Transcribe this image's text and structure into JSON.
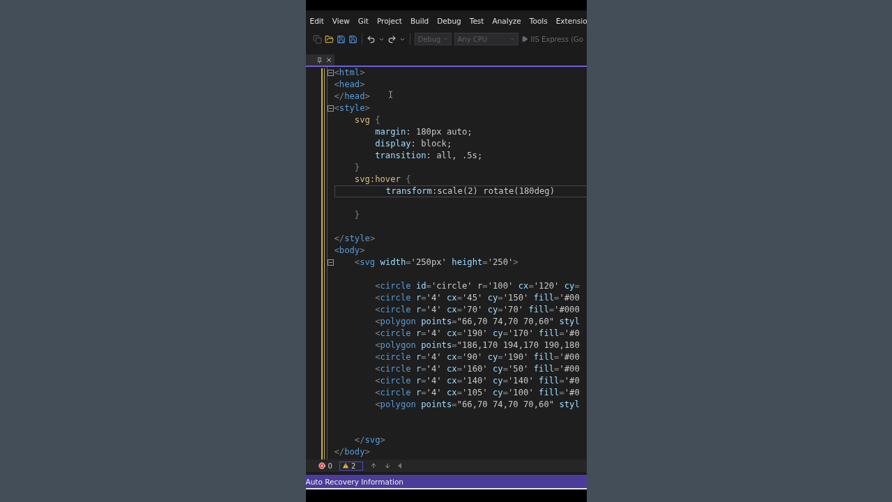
{
  "menu": [
    {
      "label": "Edit"
    },
    {
      "label": "View"
    },
    {
      "label": "Git"
    },
    {
      "label": "Project"
    },
    {
      "label": "Build"
    },
    {
      "label": "Debug"
    },
    {
      "label": "Test"
    },
    {
      "label": "Analyze"
    },
    {
      "label": "Tools"
    },
    {
      "label": "Extensio"
    }
  ],
  "toolbar": {
    "configuration": {
      "value": "Debug",
      "disabled": true
    },
    "platform": {
      "value": "Any CPU",
      "disabled": true
    },
    "run": {
      "label": "IIS Express (Go",
      "disabled": true
    }
  },
  "editor": {
    "lines": [
      {
        "kind": "code",
        "fold": true,
        "segments": [
          {
            "kind": "punct",
            "text": "<"
          },
          {
            "kind": "tag",
            "text": "html"
          },
          {
            "kind": "punct",
            "text": ">"
          }
        ]
      },
      {
        "kind": "code",
        "segments": [
          {
            "kind": "punct",
            "text": "<"
          },
          {
            "kind": "tag",
            "text": "head"
          },
          {
            "kind": "punct",
            "text": ">"
          }
        ]
      },
      {
        "kind": "code",
        "segments": [
          {
            "kind": "punct",
            "text": "</"
          },
          {
            "kind": "tag",
            "text": "head"
          },
          {
            "kind": "punct",
            "text": ">"
          }
        ]
      },
      {
        "kind": "code",
        "fold": true,
        "segments": [
          {
            "kind": "punct",
            "text": "<"
          },
          {
            "kind": "tag",
            "text": "style"
          },
          {
            "kind": "punct",
            "text": ">"
          }
        ]
      },
      {
        "kind": "code",
        "segments": [
          {
            "kind": "selector",
            "text": "    svg"
          },
          {
            "kind": "punct",
            "text": " {"
          }
        ]
      },
      {
        "kind": "code",
        "segments": [
          {
            "kind": "property",
            "text": "        margin"
          },
          {
            "kind": "value",
            "text": ": 180px auto;"
          }
        ]
      },
      {
        "kind": "code",
        "segments": [
          {
            "kind": "property",
            "text": "        display"
          },
          {
            "kind": "value",
            "text": ": block;"
          }
        ]
      },
      {
        "kind": "code",
        "segments": [
          {
            "kind": "property",
            "text": "        transition"
          },
          {
            "kind": "value",
            "text": ": all, .5s;"
          }
        ]
      },
      {
        "kind": "code",
        "segments": [
          {
            "kind": "punct",
            "text": "    }"
          }
        ]
      },
      {
        "kind": "code",
        "segments": [
          {
            "kind": "selector",
            "text": "    svg:hover"
          },
          {
            "kind": "punct",
            "text": " {"
          }
        ]
      },
      {
        "kind": "code",
        "current": true,
        "segments": [
          {
            "kind": "property",
            "text": "          transform"
          },
          {
            "kind": "value",
            "text": ":scale(2) rotate(180deg)"
          }
        ]
      },
      {
        "kind": "blank"
      },
      {
        "kind": "code",
        "segments": [
          {
            "kind": "punct",
            "text": "    }"
          }
        ]
      },
      {
        "kind": "blank"
      },
      {
        "kind": "code",
        "segments": [
          {
            "kind": "punct",
            "text": "</"
          },
          {
            "kind": "tag",
            "text": "style"
          },
          {
            "kind": "punct",
            "text": ">"
          }
        ]
      },
      {
        "kind": "code",
        "segments": [
          {
            "kind": "punct",
            "text": "<"
          },
          {
            "kind": "tag",
            "text": "body"
          },
          {
            "kind": "punct",
            "text": ">"
          }
        ]
      },
      {
        "kind": "code",
        "fold": true,
        "segments": [
          {
            "kind": "punct",
            "text": "    <"
          },
          {
            "kind": "tag",
            "text": "svg"
          },
          {
            "kind": "attr",
            "text": " width"
          },
          {
            "kind": "punct",
            "text": "="
          },
          {
            "kind": "value",
            "text": "'250px'"
          },
          {
            "kind": "attr",
            "text": " height"
          },
          {
            "kind": "punct",
            "text": "="
          },
          {
            "kind": "value",
            "text": "'250'"
          },
          {
            "kind": "punct",
            "text": ">"
          }
        ]
      },
      {
        "kind": "blank"
      },
      {
        "kind": "code",
        "segments": [
          {
            "kind": "punct",
            "text": "        <"
          },
          {
            "kind": "tag",
            "text": "circle"
          },
          {
            "kind": "attr",
            "text": " id"
          },
          {
            "kind": "punct",
            "text": "="
          },
          {
            "kind": "value",
            "text": "'circle'"
          },
          {
            "kind": "attr",
            "text": " r"
          },
          {
            "kind": "punct",
            "text": "="
          },
          {
            "kind": "value",
            "text": "'100'"
          },
          {
            "kind": "attr",
            "text": " cx"
          },
          {
            "kind": "punct",
            "text": "="
          },
          {
            "kind": "value",
            "text": "'120'"
          },
          {
            "kind": "attr",
            "text": " cy"
          },
          {
            "kind": "punct",
            "text": "="
          }
        ]
      },
      {
        "kind": "code",
        "segments": [
          {
            "kind": "punct",
            "text": "        <"
          },
          {
            "kind": "tag",
            "text": "circle"
          },
          {
            "kind": "attr",
            "text": " r"
          },
          {
            "kind": "punct",
            "text": "="
          },
          {
            "kind": "value",
            "text": "'4'"
          },
          {
            "kind": "attr",
            "text": " cx"
          },
          {
            "kind": "punct",
            "text": "="
          },
          {
            "kind": "value",
            "text": "'45'"
          },
          {
            "kind": "attr",
            "text": " cy"
          },
          {
            "kind": "punct",
            "text": "="
          },
          {
            "kind": "value",
            "text": "'150'"
          },
          {
            "kind": "attr",
            "text": " fill"
          },
          {
            "kind": "punct",
            "text": "="
          },
          {
            "kind": "value",
            "text": "'#00"
          }
        ]
      },
      {
        "kind": "code",
        "segments": [
          {
            "kind": "punct",
            "text": "        <"
          },
          {
            "kind": "tag",
            "text": "circle"
          },
          {
            "kind": "attr",
            "text": " r"
          },
          {
            "kind": "punct",
            "text": "="
          },
          {
            "kind": "value",
            "text": "'4'"
          },
          {
            "kind": "attr",
            "text": " cx"
          },
          {
            "kind": "punct",
            "text": "="
          },
          {
            "kind": "value",
            "text": "'70'"
          },
          {
            "kind": "attr",
            "text": " cy"
          },
          {
            "kind": "punct",
            "text": "="
          },
          {
            "kind": "value",
            "text": "'70'"
          },
          {
            "kind": "attr",
            "text": " fill"
          },
          {
            "kind": "punct",
            "text": "="
          },
          {
            "kind": "value",
            "text": "'#000"
          }
        ]
      },
      {
        "kind": "code",
        "segments": [
          {
            "kind": "punct",
            "text": "        <"
          },
          {
            "kind": "tag",
            "text": "polygon"
          },
          {
            "kind": "attr",
            "text": " points"
          },
          {
            "kind": "punct",
            "text": "="
          },
          {
            "kind": "value",
            "text": "\"66,70 74,70 70,60\""
          },
          {
            "kind": "attr",
            "text": " styl"
          }
        ]
      },
      {
        "kind": "code",
        "segments": [
          {
            "kind": "punct",
            "text": "        <"
          },
          {
            "kind": "tag",
            "text": "circle"
          },
          {
            "kind": "attr",
            "text": " r"
          },
          {
            "kind": "punct",
            "text": "="
          },
          {
            "kind": "value",
            "text": "'4'"
          },
          {
            "kind": "attr",
            "text": " cx"
          },
          {
            "kind": "punct",
            "text": "="
          },
          {
            "kind": "value",
            "text": "'190'"
          },
          {
            "kind": "attr",
            "text": " cy"
          },
          {
            "kind": "punct",
            "text": "="
          },
          {
            "kind": "value",
            "text": "'170'"
          },
          {
            "kind": "attr",
            "text": " fill"
          },
          {
            "kind": "punct",
            "text": "="
          },
          {
            "kind": "value",
            "text": "'#0"
          }
        ]
      },
      {
        "kind": "code",
        "segments": [
          {
            "kind": "punct",
            "text": "        <"
          },
          {
            "kind": "tag",
            "text": "polygon"
          },
          {
            "kind": "attr",
            "text": " points"
          },
          {
            "kind": "punct",
            "text": "="
          },
          {
            "kind": "value",
            "text": "\"186,170 194,170 190,180"
          }
        ]
      },
      {
        "kind": "code",
        "segments": [
          {
            "kind": "punct",
            "text": "        <"
          },
          {
            "kind": "tag",
            "text": "circle"
          },
          {
            "kind": "attr",
            "text": " r"
          },
          {
            "kind": "punct",
            "text": "="
          },
          {
            "kind": "value",
            "text": "'4'"
          },
          {
            "kind": "attr",
            "text": " cx"
          },
          {
            "kind": "punct",
            "text": "="
          },
          {
            "kind": "value",
            "text": "'90'"
          },
          {
            "kind": "attr",
            "text": " cy"
          },
          {
            "kind": "punct",
            "text": "="
          },
          {
            "kind": "value",
            "text": "'190'"
          },
          {
            "kind": "attr",
            "text": " fill"
          },
          {
            "kind": "punct",
            "text": "="
          },
          {
            "kind": "value",
            "text": "'#00"
          }
        ]
      },
      {
        "kind": "code",
        "segments": [
          {
            "kind": "punct",
            "text": "        <"
          },
          {
            "kind": "tag",
            "text": "circle"
          },
          {
            "kind": "attr",
            "text": " r"
          },
          {
            "kind": "punct",
            "text": "="
          },
          {
            "kind": "value",
            "text": "'4'"
          },
          {
            "kind": "attr",
            "text": " cx"
          },
          {
            "kind": "punct",
            "text": "="
          },
          {
            "kind": "value",
            "text": "'160'"
          },
          {
            "kind": "attr",
            "text": " cy"
          },
          {
            "kind": "punct",
            "text": "="
          },
          {
            "kind": "value",
            "text": "'50'"
          },
          {
            "kind": "attr",
            "text": " fill"
          },
          {
            "kind": "punct",
            "text": "="
          },
          {
            "kind": "value",
            "text": "'#00"
          }
        ]
      },
      {
        "kind": "code",
        "segments": [
          {
            "kind": "punct",
            "text": "        <"
          },
          {
            "kind": "tag",
            "text": "circle"
          },
          {
            "kind": "attr",
            "text": " r"
          },
          {
            "kind": "punct",
            "text": "="
          },
          {
            "kind": "value",
            "text": "'4'"
          },
          {
            "kind": "attr",
            "text": " cx"
          },
          {
            "kind": "punct",
            "text": "="
          },
          {
            "kind": "value",
            "text": "'140'"
          },
          {
            "kind": "attr",
            "text": " cy"
          },
          {
            "kind": "punct",
            "text": "="
          },
          {
            "kind": "value",
            "text": "'140'"
          },
          {
            "kind": "attr",
            "text": " fill"
          },
          {
            "kind": "punct",
            "text": "="
          },
          {
            "kind": "value",
            "text": "'#0"
          }
        ]
      },
      {
        "kind": "code",
        "segments": [
          {
            "kind": "punct",
            "text": "        <"
          },
          {
            "kind": "tag",
            "text": "circle"
          },
          {
            "kind": "attr",
            "text": " r"
          },
          {
            "kind": "punct",
            "text": "="
          },
          {
            "kind": "value",
            "text": "'4'"
          },
          {
            "kind": "attr",
            "text": " cx"
          },
          {
            "kind": "punct",
            "text": "="
          },
          {
            "kind": "value",
            "text": "'105'"
          },
          {
            "kind": "attr",
            "text": " cy"
          },
          {
            "kind": "punct",
            "text": "="
          },
          {
            "kind": "value",
            "text": "'100'"
          },
          {
            "kind": "attr",
            "text": " fill"
          },
          {
            "kind": "punct",
            "text": "="
          },
          {
            "kind": "value",
            "text": "'#0"
          }
        ]
      },
      {
        "kind": "code",
        "segments": [
          {
            "kind": "punct",
            "text": "        <"
          },
          {
            "kind": "tag",
            "text": "polygon"
          },
          {
            "kind": "attr",
            "text": " points"
          },
          {
            "kind": "punct",
            "text": "="
          },
          {
            "kind": "value",
            "text": "\"66,70 74,70 70,60\""
          },
          {
            "kind": "attr",
            "text": " styl"
          }
        ]
      },
      {
        "kind": "blank"
      },
      {
        "kind": "blank"
      },
      {
        "kind": "code",
        "segments": [
          {
            "kind": "punct",
            "text": "    </"
          },
          {
            "kind": "tag",
            "text": "svg"
          },
          {
            "kind": "punct",
            "text": ">"
          }
        ]
      },
      {
        "kind": "code",
        "segments": [
          {
            "kind": "punct",
            "text": "</"
          },
          {
            "kind": "tag",
            "text": "body"
          },
          {
            "kind": "punct",
            "text": ">"
          }
        ]
      }
    ]
  },
  "status": {
    "errors": "0",
    "warnings": "2"
  },
  "notification_bar": {
    "text": "Auto Recovery Information"
  }
}
